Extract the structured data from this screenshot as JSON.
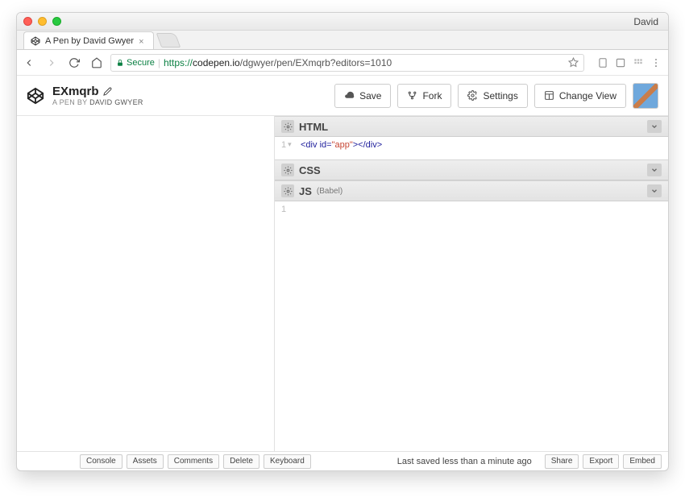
{
  "browser": {
    "user": "David",
    "tab_title": "A Pen by David Gwyer",
    "secure_label": "Secure",
    "url_protocol": "https://",
    "url_host": "codepen.io",
    "url_path": "/dgwyer/pen/EXmqrb?editors=1010"
  },
  "header": {
    "title": "EXmqrb",
    "subtitle_prefix": "A PEN BY ",
    "author": "David Gwyer",
    "buttons": {
      "save": "Save",
      "fork": "Fork",
      "settings": "Settings",
      "change_view": "Change View"
    }
  },
  "panels": {
    "html": {
      "label": "HTML",
      "line_num": "1",
      "code_html": "<div id=\"app\"></div>"
    },
    "css": {
      "label": "CSS"
    },
    "js": {
      "label": "JS",
      "preprocessor": "(Babel)",
      "line_num": "1"
    }
  },
  "footer": {
    "buttons": [
      "Console",
      "Assets",
      "Comments",
      "Delete",
      "Keyboard"
    ],
    "status": "Last saved less than a minute ago",
    "right_buttons": [
      "Share",
      "Export",
      "Embed"
    ]
  }
}
